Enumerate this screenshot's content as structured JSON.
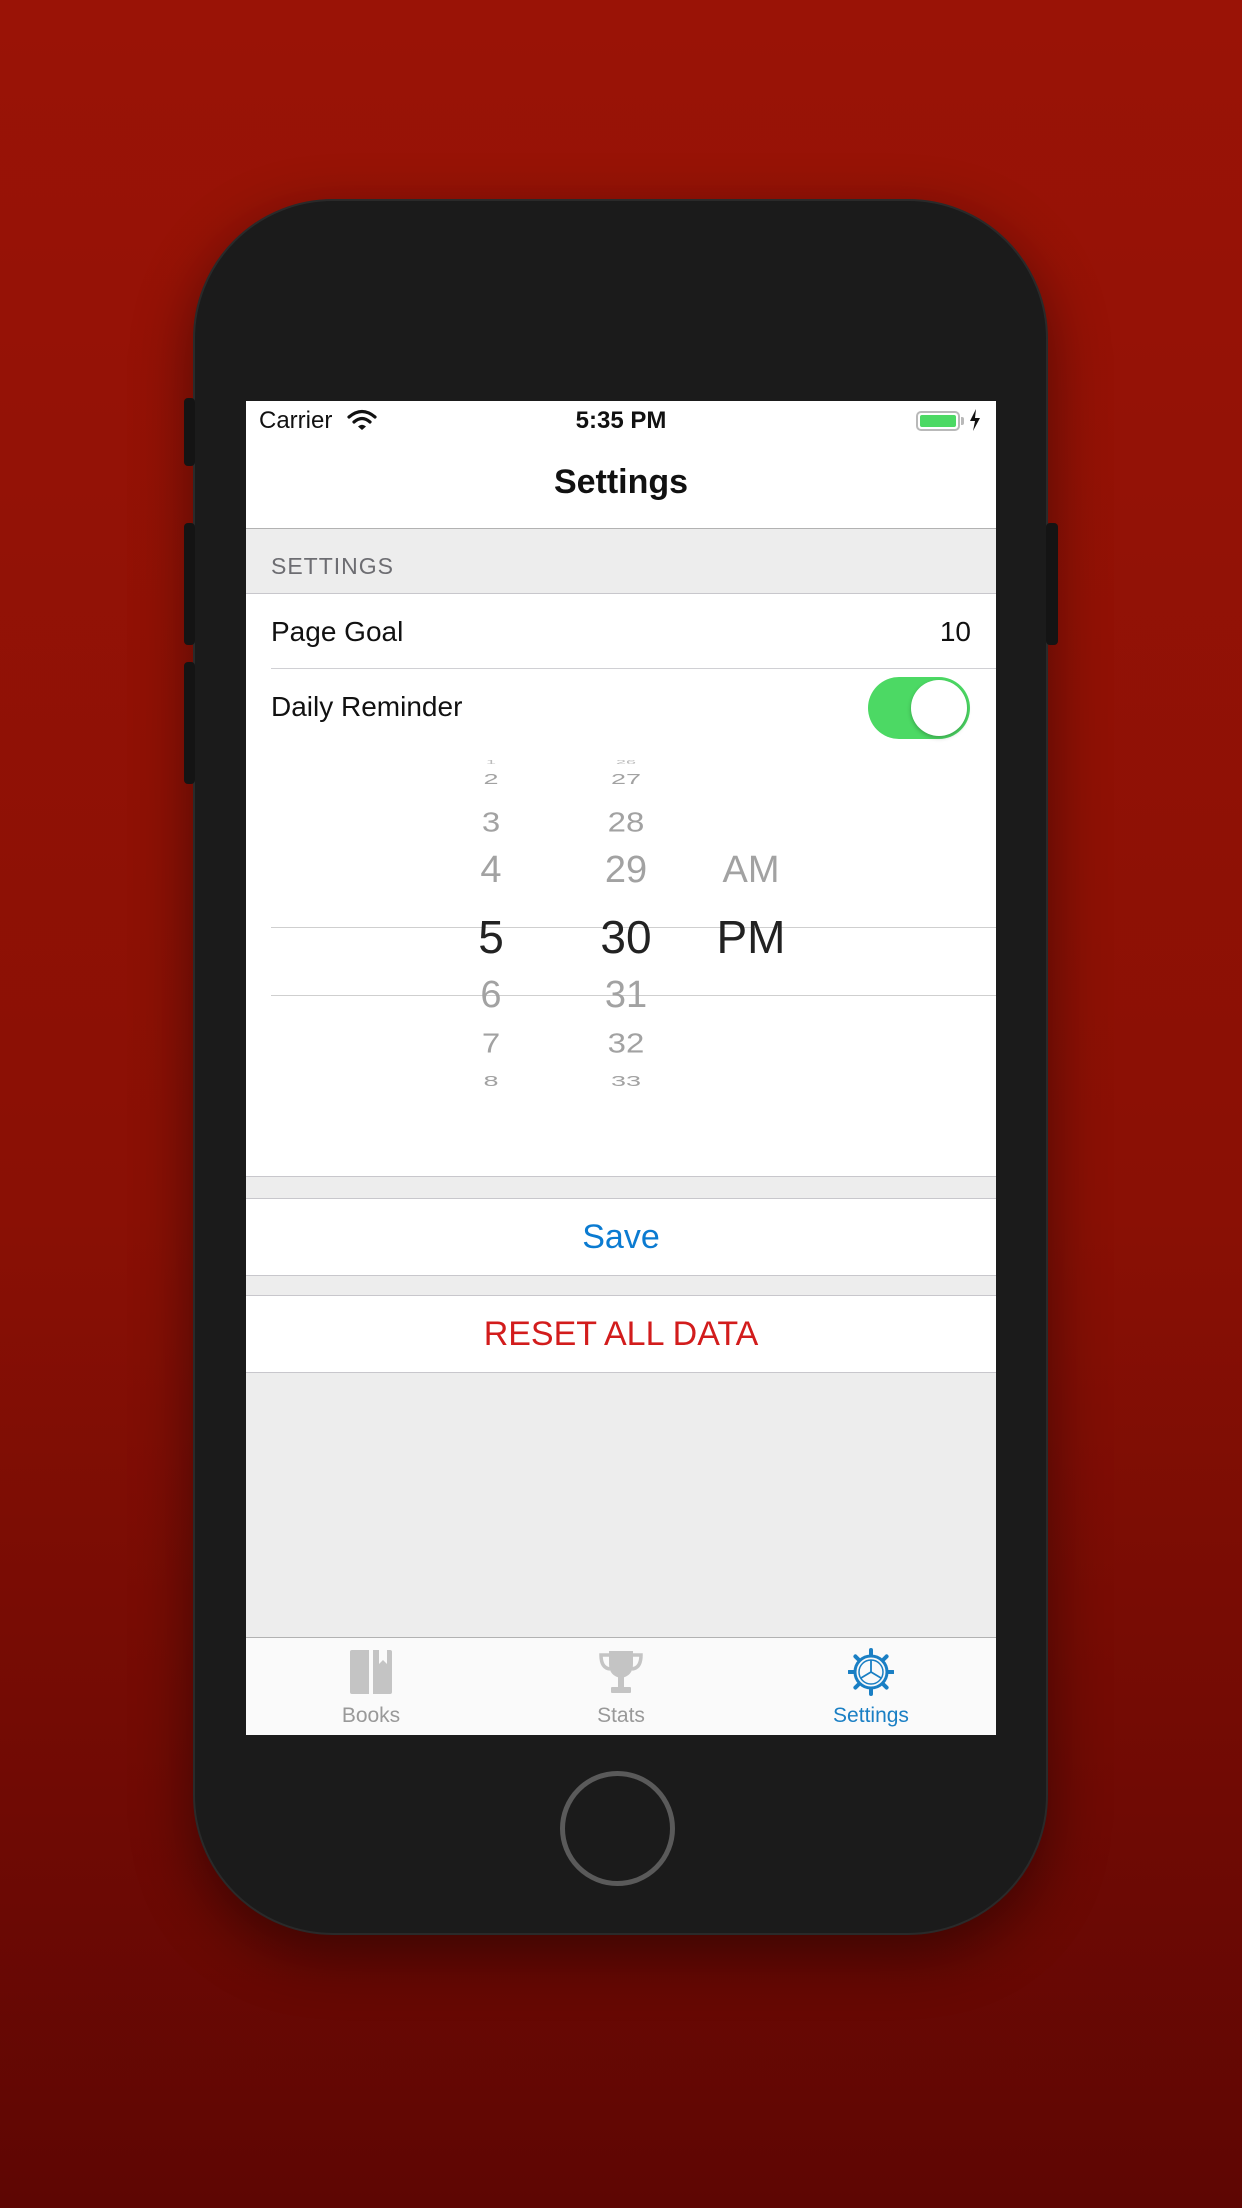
{
  "status_bar": {
    "carrier": "Carrier",
    "time": "5:35 PM"
  },
  "nav": {
    "title": "Settings"
  },
  "section": {
    "header": "SETTINGS"
  },
  "rows": {
    "page_goal": {
      "label": "Page Goal",
      "value": "10"
    },
    "daily_reminder": {
      "label": "Daily Reminder",
      "enabled": true
    }
  },
  "time_picker": {
    "hour": {
      "above": [
        "2",
        "3",
        "4"
      ],
      "selected": "5",
      "below": [
        "6",
        "7",
        "8"
      ]
    },
    "minute": {
      "above": [
        "27",
        "28",
        "29"
      ],
      "selected": "30",
      "below": [
        "31",
        "32",
        "33"
      ]
    },
    "period": {
      "above": [
        "AM"
      ],
      "selected": "PM"
    }
  },
  "actions": {
    "save": "Save",
    "reset": "RESET ALL DATA"
  },
  "tabs": [
    {
      "label": "Books",
      "icon": "book-icon",
      "active": false
    },
    {
      "label": "Stats",
      "icon": "trophy-icon",
      "active": false
    },
    {
      "label": "Settings",
      "icon": "gear-icon",
      "active": true
    }
  ],
  "colors": {
    "background": "#9a1306",
    "accent": "#1a7fc4",
    "destructive": "#d21c1c",
    "toggle_on": "#4cd964"
  }
}
